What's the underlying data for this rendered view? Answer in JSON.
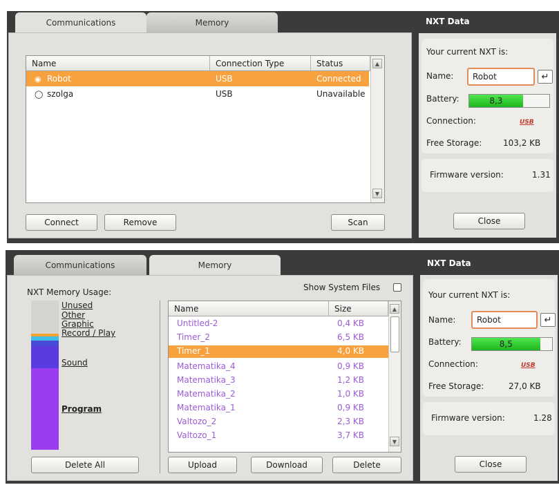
{
  "top": {
    "tabs": [
      "Communications",
      "Memory"
    ],
    "columns": [
      "Name",
      "Connection Type",
      "Status"
    ],
    "rows": [
      {
        "name": "Robot",
        "type": "USB",
        "status": "Connected",
        "selected": true
      },
      {
        "name": "szolga",
        "type": "USB",
        "status": "Unavailable",
        "selected": false
      }
    ],
    "buttons": {
      "connect": "Connect",
      "remove": "Remove",
      "scan": "Scan"
    },
    "nxt": {
      "title": "NXT Data",
      "current": "Your current NXT is:",
      "name_label": "Name:",
      "name_value": "Robot",
      "enter_icon": "↵",
      "battery_label": "Battery:",
      "battery_value": "8,3",
      "battery_level": 0.67,
      "connection_label": "Connection:",
      "connection_value": "USB",
      "storage_label": "Free Storage:",
      "storage_value": "103,2 KB",
      "firmware_label": "Firmware version:",
      "firmware_value": "1.31",
      "close": "Close"
    }
  },
  "bottom": {
    "tabs": [
      "Communications",
      "Memory"
    ],
    "usage_title": "NXT Memory Usage:",
    "usage_labels": [
      "Unused",
      "Other",
      "Graphic",
      "Record / Play",
      "Sound",
      "Program"
    ],
    "show_system_files": "Show System Files",
    "columns": [
      "Name",
      "Size"
    ],
    "files": [
      {
        "name": "Untitled-2",
        "size": "0,4 KB",
        "selected": false
      },
      {
        "name": "Timer_2",
        "size": "6,5 KB",
        "selected": false
      },
      {
        "name": "Timer_1",
        "size": "4,0 KB",
        "selected": true
      },
      {
        "name": "Matematika_4",
        "size": "0,9 KB",
        "selected": false
      },
      {
        "name": "Matematika_3",
        "size": "1,2 KB",
        "selected": false
      },
      {
        "name": "Matematika_2",
        "size": "1,0 KB",
        "selected": false
      },
      {
        "name": "Matematika_1",
        "size": "0,9 KB",
        "selected": false
      },
      {
        "name": "Valtozo_2",
        "size": "2,3 KB",
        "selected": false
      },
      {
        "name": "Valtozo_1",
        "size": "3,7 KB",
        "selected": false
      }
    ],
    "buttons": {
      "delete_all": "Delete All",
      "upload": "Upload",
      "download": "Download",
      "delete": "Delete"
    },
    "nxt": {
      "title": "NXT Data",
      "current": "Your current NXT is:",
      "name_label": "Name:",
      "name_value": "Robot",
      "enter_icon": "↵",
      "battery_label": "Battery:",
      "battery_value": "8,5",
      "battery_level": 0.85,
      "connection_label": "Connection:",
      "connection_value": "USB",
      "storage_label": "Free Storage:",
      "storage_value": "27,0 KB",
      "firmware_label": "Firmware version:",
      "firmware_value": "1.28",
      "close": "Close"
    }
  },
  "colors": {
    "selection": "#f7a13f",
    "file_text": "#9b5bd6",
    "usb": "#c0392b"
  }
}
